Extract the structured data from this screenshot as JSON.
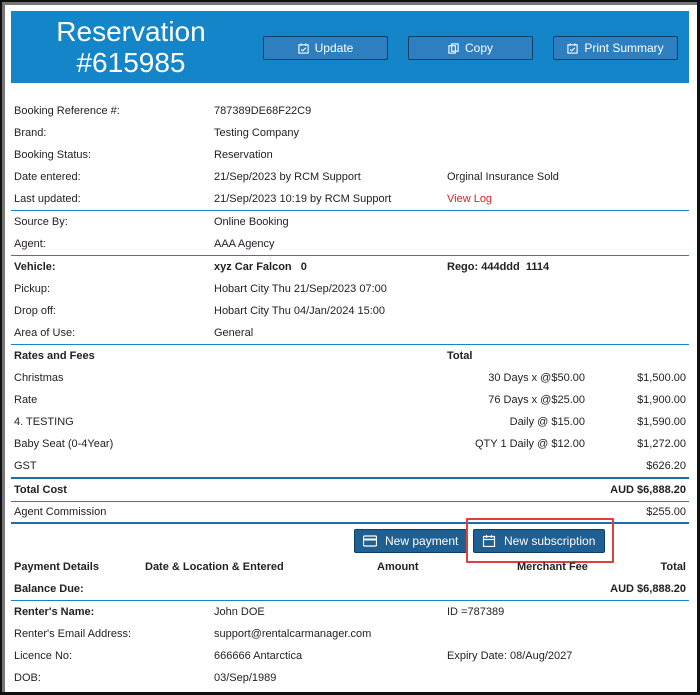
{
  "header": {
    "title_line1": "Reservation",
    "title_line2": "#615985",
    "update_label": "Update",
    "copy_label": "Copy",
    "print_label": "Print Summary"
  },
  "booking": {
    "ref_label": "Booking Reference #:",
    "ref_value": "787389DE68F22C9",
    "brand_label": "Brand:",
    "brand_value": "Testing Company",
    "status_label": "Booking Status:",
    "status_value": "Reservation",
    "entered_label": "Date entered:",
    "entered_value": "21/Sep/2023 by RCM Support",
    "insurance_note": "Orginal Insurance Sold",
    "updated_label": "Last updated:",
    "updated_value": "21/Sep/2023 10:19 by RCM Support",
    "view_log": "View Log"
  },
  "source": {
    "source_label": "Source By:",
    "source_value": "Online Booking",
    "agent_label": "Agent:",
    "agent_value": "AAA Agency"
  },
  "vehicle": {
    "vehicle_label": "Vehicle:",
    "vehicle_value": "xyz Car Falcon   0",
    "rego": "Rego: 444ddd  1114",
    "pickup_label": "Pickup:",
    "pickup_value": "Hobart City Thu 21/Sep/2023 07:00",
    "dropoff_label": "Drop off:",
    "dropoff_value": "Hobart City Thu 04/Jan/2024 15:00",
    "area_label": "Area of Use:",
    "area_value": "General"
  },
  "rates": {
    "heading": "Rates and Fees",
    "total_heading": "Total",
    "items": [
      {
        "name": "Christmas",
        "detail": "30 Days x @$50.00",
        "amount": "$1,500.00"
      },
      {
        "name": "Rate",
        "detail": "76 Days x @$25.00",
        "amount": "$1,900.00"
      },
      {
        "name": "4. TESTING",
        "detail": "Daily @ $15.00",
        "amount": "$1,590.00"
      },
      {
        "name": "Baby Seat (0-4Year)",
        "detail": "QTY 1 Daily @ $12.00",
        "amount": "$1,272.00"
      },
      {
        "name": "GST",
        "detail": "",
        "amount": "$626.20"
      }
    ],
    "total_cost_label": "Total Cost",
    "total_cost_value": "AUD $6,888.20",
    "commission_label": "Agent Commission",
    "commission_value": "$255.00"
  },
  "payment_buttons": {
    "new_payment": "New payment",
    "new_subscription": "New subscription"
  },
  "payment_table": {
    "col_details": "Payment Details",
    "col_date": "Date & Location & Entered",
    "col_amount": "Amount",
    "col_fee": "Merchant Fee",
    "col_total": "Total",
    "balance_label": "Balance Due:",
    "balance_value": "AUD $6,888.20"
  },
  "renter": {
    "name_label": "Renter's Name:",
    "name_value": "John DOE",
    "id_value": "ID =787389",
    "email_label": "Renter's Email Address:",
    "email_value": "support@rentalcarmanager.com",
    "licence_label": "Licence No:",
    "licence_value": "666666 Antarctica",
    "expiry_value": "Expiry Date: 08/Aug/2027",
    "dob_label": "DOB:",
    "dob_value": "03/Sep/1989"
  },
  "colors": {
    "header_bg": "#1385c8",
    "button_bg": "#205f91",
    "highlight": "#e0403a",
    "link_red": "#e02020"
  }
}
